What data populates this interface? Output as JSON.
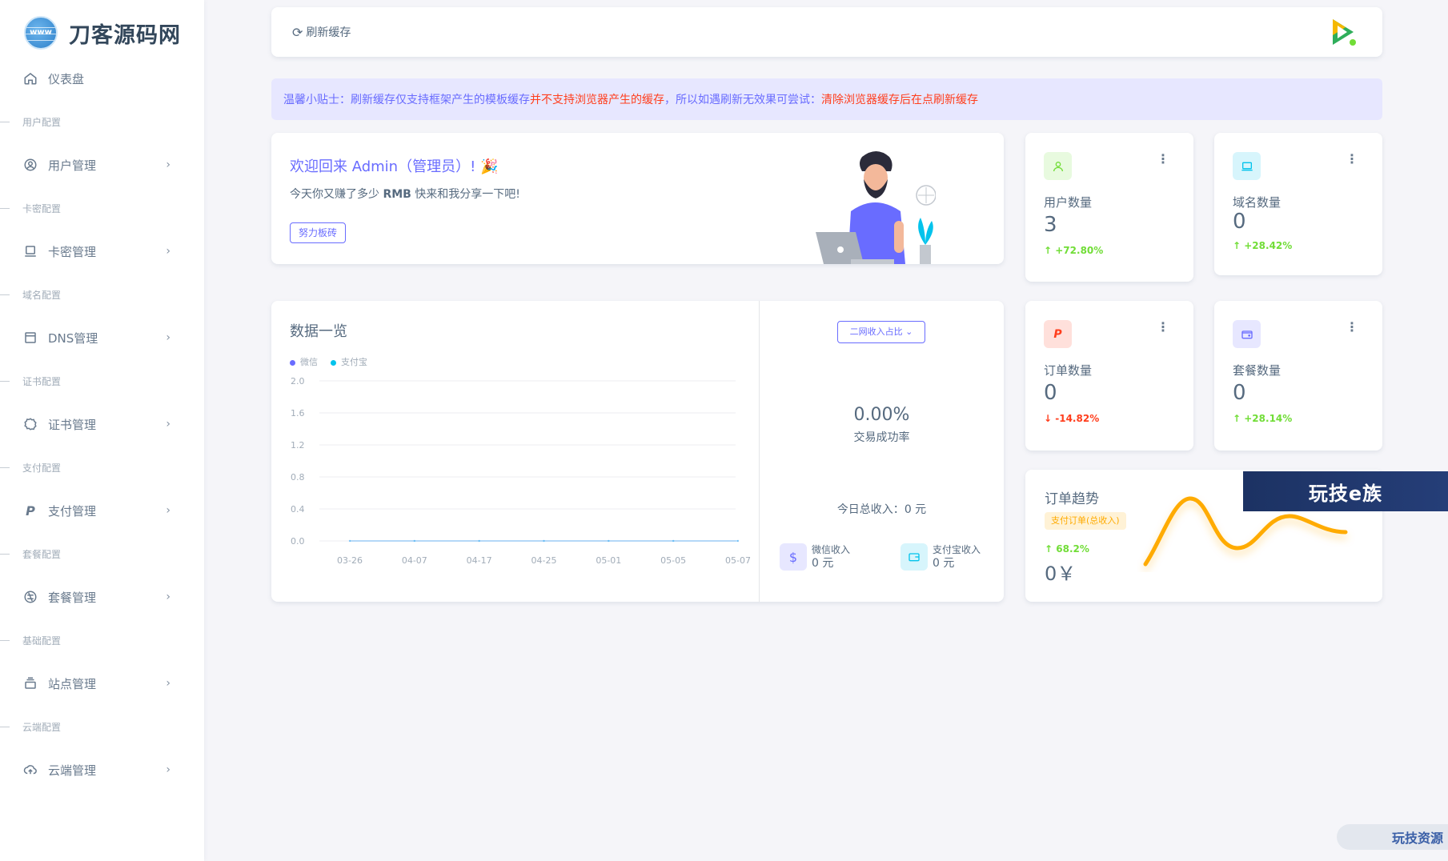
{
  "brand": {
    "name": "刀客源码网"
  },
  "sidebar": {
    "dashboard": "仪表盘",
    "sections": [
      {
        "header": "用户配置",
        "item": "用户管理",
        "icon": "user-circle-icon"
      },
      {
        "header": "卡密配置",
        "item": "卡密管理",
        "icon": "laptop-icon"
      },
      {
        "header": "域名配置",
        "item": "DNS管理",
        "icon": "window-icon"
      },
      {
        "header": "证书配置",
        "item": "证书管理",
        "icon": "badge-icon"
      },
      {
        "header": "支付配置",
        "item": "支付管理",
        "icon": "paypal-icon"
      },
      {
        "header": "套餐配置",
        "item": "套餐管理",
        "icon": "package-icon"
      },
      {
        "header": "基础配置",
        "item": "站点管理",
        "icon": "server-icon"
      },
      {
        "header": "云端配置",
        "item": "云端管理",
        "icon": "cloud-upload-icon"
      }
    ]
  },
  "topbar": {
    "refresh_label": "刷新缓存"
  },
  "notice": {
    "part1": "温馨小贴士：刷新缓存仅支持框架产生的模板缓存",
    "part2": "并不支持浏览器产生的缓存",
    "part3": "，所以如遇刷新无效果可尝试：",
    "part4": "清除浏览器缓存后在点刷新缓存"
  },
  "welcome": {
    "title": "欢迎回来 Admin（管理员）!",
    "subtitle_before": "今天你又赚了多少 ",
    "subtitle_bold": "RMB",
    "subtitle_after": " 快来和我分享一下吧!",
    "button": "努力板砖"
  },
  "stats": [
    {
      "label": "用户数量",
      "value": "3",
      "trend": "+72.80%",
      "direction": "up",
      "color": "#71dd37",
      "bg": "#e8fadf"
    },
    {
      "label": "域名数量",
      "value": "0",
      "trend": "+28.42%",
      "direction": "up",
      "color": "#03c3ec",
      "bg": "#d7f5fc"
    },
    {
      "label": "订单数量",
      "value": "0",
      "trend": "-14.82%",
      "direction": "down",
      "color": "#ff3e1d",
      "bg": "#ffe0db"
    },
    {
      "label": "套餐数量",
      "value": "0",
      "trend": "+28.14%",
      "direction": "up",
      "color": "#696cff",
      "bg": "#e7e7ff"
    }
  ],
  "overview": {
    "title": "数据一览",
    "legend": [
      "微信",
      "支付宝"
    ],
    "select_label": "二网收入占比",
    "rate": "0.00%",
    "rate_label": "交易成功率",
    "total_label": "今日总收入：",
    "total_value": "0 元",
    "wechat_label": "微信收入",
    "wechat_value": "0 元",
    "alipay_label": "支付宝收入",
    "alipay_value": "0 元"
  },
  "chart_data": {
    "type": "line",
    "categories": [
      "03-26",
      "04-07",
      "04-17",
      "04-25",
      "05-01",
      "05-05",
      "05-07"
    ],
    "series": [
      {
        "name": "微信",
        "values": [
          0,
          0,
          0,
          0,
          0,
          0,
          0
        ],
        "color": "#696cff"
      },
      {
        "name": "支付宝",
        "values": [
          0,
          0,
          0,
          0,
          0,
          0,
          0
        ],
        "color": "#03c3ec"
      }
    ],
    "yticks": [
      "2.0",
      "1.6",
      "1.2",
      "0.8",
      "0.4",
      "0.0"
    ],
    "ylim": [
      0,
      2.0
    ],
    "grid": true,
    "legend_position": "top-left"
  },
  "trend": {
    "title": "订单趋势",
    "badge": "支付订单(总收入)",
    "pct": "68.2%",
    "value": "0￥"
  },
  "watermarks": {
    "top": "玩技e族",
    "bottom": "玩技资源"
  }
}
